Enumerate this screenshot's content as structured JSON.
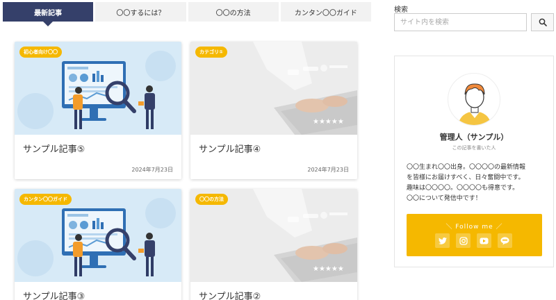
{
  "tabs": [
    {
      "label": "最新記事",
      "active": true
    },
    {
      "label": "〇〇するには？",
      "active": false
    },
    {
      "label": "〇〇の方法",
      "active": false
    },
    {
      "label": "カンタン〇〇ガイド",
      "active": false
    }
  ],
  "posts": [
    {
      "badge": "初心者向け〇〇",
      "title": "サンプル記事⑤",
      "date": "2024年7月23日",
      "image": "business-analytics"
    },
    {
      "badge": "カテゴリ①",
      "title": "サンプル記事④",
      "date": "2024年7月23日",
      "image": "laptop-typing"
    },
    {
      "badge": "カンタン〇〇ガイド",
      "title": "サンプル記事③",
      "date": "",
      "image": "business-analytics"
    },
    {
      "badge": "〇〇の方法",
      "title": "サンプル記事②",
      "date": "",
      "image": "laptop-typing"
    }
  ],
  "sidebar": {
    "search_label": "検索",
    "search_placeholder": "サイト内を検索",
    "search_icon": "search-icon",
    "profile": {
      "name": "管理人（サンプル）",
      "subtitle": "この記事を書いた人",
      "bio": [
        "〇〇生まれ〇〇出身。〇〇〇〇の最新情報",
        "を皆様にお届けすべく、日々奮闘中です。",
        "趣味は〇〇〇〇。〇〇〇〇も得意です。",
        "〇〇について発信中です！"
      ],
      "follow_title": "＼ Follow me ／",
      "sns": [
        "twitter-icon",
        "instagram-icon",
        "youtube-icon",
        "line-icon"
      ]
    }
  },
  "colors": {
    "tab_active": "#35406a",
    "accent": "#f5b800"
  }
}
